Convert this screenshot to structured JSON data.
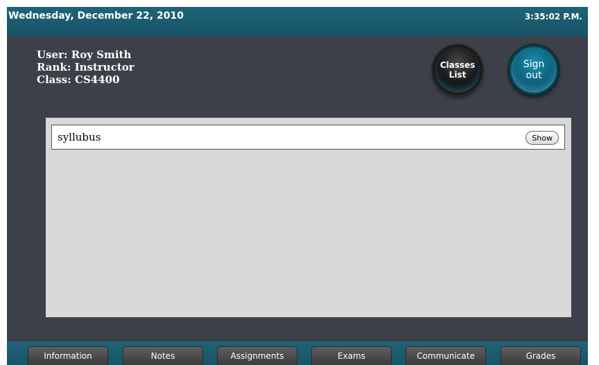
{
  "header": {
    "date": "Wednesday, December 22, 2010",
    "time": "3:35:02 P.M."
  },
  "user": {
    "user_line": "User: Roy Smith",
    "rank_line": "Rank: Instructor",
    "class_line": "Class: CS4400"
  },
  "buttons": {
    "classes_list_line1": "Classes",
    "classes_list_line2": "List",
    "sign_out_line1": "Sign",
    "sign_out_line2": "out"
  },
  "content": {
    "items": [
      {
        "label": "syllubus",
        "action": "Show"
      }
    ]
  },
  "tabs": [
    {
      "label": "Information"
    },
    {
      "label": "Notes"
    },
    {
      "label": "Assignments"
    },
    {
      "label": "Exams"
    },
    {
      "label": "Communicate"
    },
    {
      "label": "Grades"
    }
  ],
  "colors": {
    "header_bg": "#1f6378",
    "app_bg": "#3c4048",
    "content_bg": "#d8d8d8",
    "sign_out_accent": "#1d8fb0"
  }
}
